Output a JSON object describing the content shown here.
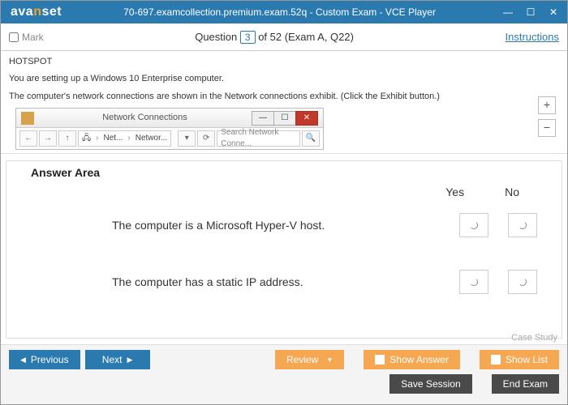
{
  "titlebar": {
    "logo_part1": "ava",
    "logo_part2": "n",
    "logo_part3": "set",
    "title": "70-697.examcollection.premium.exam.52q - Custom Exam - VCE Player"
  },
  "qbar": {
    "mark_label": "Mark",
    "question_label": "Question",
    "question_number": "3",
    "question_suffix": " of 52 (Exam A, Q22)",
    "instructions_label": "Instructions"
  },
  "question": {
    "line1": "HOTSPOT",
    "line2": "You are setting up a Windows 10 Enterprise computer.",
    "line3": "The computer's network connections are shown in the Network connections exhibit. (Click the Exhibit button.)"
  },
  "exhibit": {
    "window_title": "Network Connections",
    "crumb1": "Net...",
    "crumb2": "Networ...",
    "search_placeholder": "Search Network Conne..."
  },
  "answer_area": {
    "title": "Answer Area",
    "head_yes": "Yes",
    "head_no": "No",
    "rows": [
      "The computer is a Microsoft Hyper-V host.",
      "The computer has a static IP address."
    ]
  },
  "case_study_label": "Case Study",
  "footer": {
    "previous": "Previous",
    "next": "Next",
    "review": "Review",
    "show_answer": "Show Answer",
    "show_list": "Show List",
    "save_session": "Save Session",
    "end_exam": "End Exam"
  }
}
